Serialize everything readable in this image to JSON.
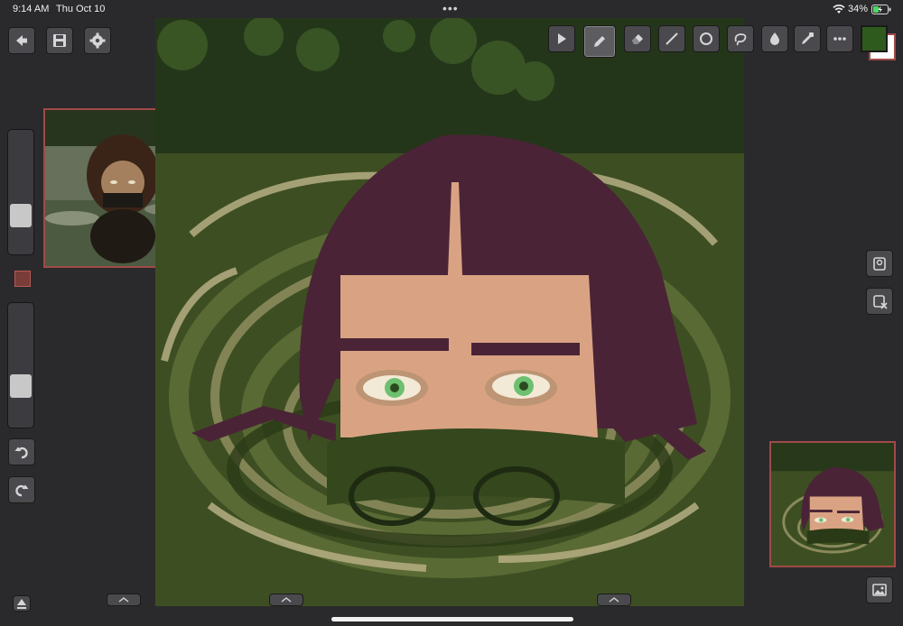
{
  "status_bar": {
    "time": "9:14 AM",
    "date": "Thu Oct 10",
    "multitask_indicator": "•••",
    "battery_percent": "34%",
    "wifi_icon": "wifi-icon",
    "battery_icon": "battery-charging-icon"
  },
  "left_toolbar": {
    "buttons": [
      "back-arrow-icon",
      "save-icon",
      "settings-gear-icon"
    ],
    "slider_top": {
      "name": "brush-size-slider",
      "value_fraction": 0.3
    },
    "slider_bottom": {
      "name": "opacity-slider",
      "value_fraction": 0.35
    },
    "undo_icon": "undo-icon",
    "redo_icon": "redo-icon"
  },
  "top_toolbar": {
    "tools": [
      {
        "name": "play-tool",
        "icon": "play-icon"
      },
      {
        "name": "pencil-tool",
        "icon": "pencil-icon",
        "active": true
      },
      {
        "name": "eraser-tool",
        "icon": "eraser-icon"
      },
      {
        "name": "line-tool",
        "icon": "line-icon"
      },
      {
        "name": "circle-tool",
        "icon": "circle-icon"
      },
      {
        "name": "lasso-tool",
        "icon": "lasso-icon"
      },
      {
        "name": "fill-tool",
        "icon": "fill-drop-icon"
      },
      {
        "name": "eyedropper-tool",
        "icon": "eyedropper-icon"
      },
      {
        "name": "more-tool",
        "icon": "more-icon"
      }
    ],
    "primary_color": "#2f5a1e",
    "secondary_color": "#ffffff"
  },
  "right_toolbar": {
    "buttons": [
      "reference-image-icon",
      "reference-remove-icon"
    ],
    "gallery_icon": "gallery-image-icon"
  },
  "colors": {
    "background": "#2a2a2c",
    "panel_border": "#a04a48",
    "hair": "#4a2436",
    "skin": "#d9a383",
    "water_dark": "#27391a",
    "water_mid": "#4a5e2a",
    "water_light": "#a8a478",
    "eye_green": "#6cc070"
  }
}
